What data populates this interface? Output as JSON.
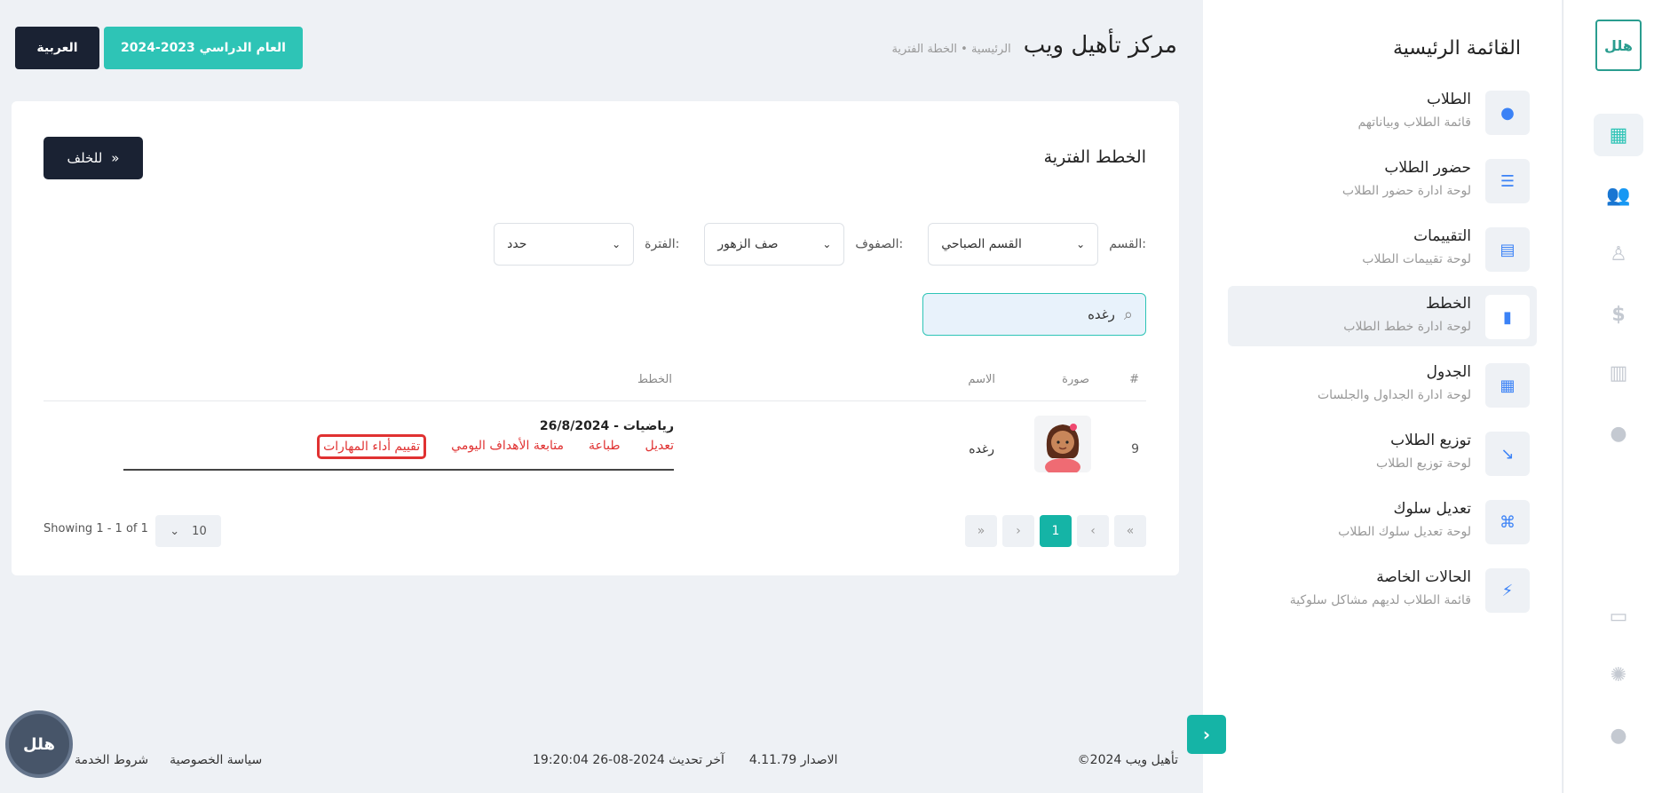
{
  "rail": {
    "logo_text": "هلل",
    "icons": [
      "dashboard-icon",
      "users-icon",
      "graduation-icon",
      "dollar-icon",
      "building-icon",
      "globe-icon",
      "chat-icon",
      "settings-icon",
      "user-icon"
    ]
  },
  "menu": {
    "title": "القائمة الرئيسية",
    "items": [
      {
        "title": "الطلاب",
        "subtitle": "قائمة الطلاب وبياناتهم",
        "icon": "student-icon"
      },
      {
        "title": "حضور الطلاب",
        "subtitle": "لوحة ادارة حضور الطلاب",
        "icon": "list-icon"
      },
      {
        "title": "التقييمات",
        "subtitle": "لوحة تقييمات الطلاب",
        "icon": "layout-icon"
      },
      {
        "title": "الخطط",
        "subtitle": "لوحة ادارة خطط الطلاب",
        "icon": "document-icon"
      },
      {
        "title": "الجدول",
        "subtitle": "لوحة ادارة الجداول والجلسات",
        "icon": "grid-icon"
      },
      {
        "title": "توزيع الطلاب",
        "subtitle": "لوحة توزيع الطلاب",
        "icon": "distribute-icon"
      },
      {
        "title": "تعديل سلوك",
        "subtitle": "لوحة تعديل سلوك الطلاب",
        "icon": "command-icon"
      },
      {
        "title": "الحالات الخاصة",
        "subtitle": "قائمة الطلاب لديهم مشاكل سلوكية",
        "icon": "bolt-icon"
      }
    ]
  },
  "header": {
    "site_name": "مركز تأهيل ويب",
    "breadcrumb": "الرئيسية • الخطة الفترية",
    "academic_year": "العام الدراسي 2023-2024",
    "language": "العربية"
  },
  "card": {
    "title": "الخطط الفترية",
    "back_label": "للخلف",
    "filters": {
      "section_label": "القسم:",
      "section_value": "القسم الصباحي",
      "class_label": "الصفوف:",
      "class_value": "صف الزهور",
      "period_label": "الفترة:",
      "period_value": "حدد"
    },
    "search_value": "رغده",
    "columns": [
      "#",
      "صورة",
      "الاسم",
      "الخطط"
    ],
    "rows": [
      {
        "num": "9",
        "name": "رغده",
        "plan_title": "رياضيات - 26/8/2024",
        "actions": [
          "تعديل",
          "طباعة",
          "متابعة الأهداف اليومي",
          "تقييم أداء المهارات"
        ]
      }
    ],
    "pagination": {
      "first": "«",
      "prev": "‹",
      "current": "1",
      "next": "›",
      "last": "»",
      "per_page": "10",
      "showing": "Showing 1 - 1 of 1"
    }
  },
  "footer": {
    "copyright": "©2024  تأهيل ويب",
    "version": "الاصدار 4.11.79",
    "last_update": "آخر تحديث 2024-08-26 19:20:04",
    "privacy": "سياسة الخصوصية",
    "terms": "شروط الخدمة"
  }
}
